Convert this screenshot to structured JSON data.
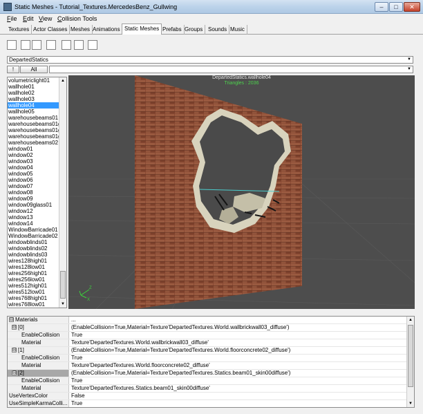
{
  "window": {
    "title": "Static Meshes - Tutorial_Textures.MercedesBenz_Gullwing",
    "min": "–",
    "max": "□",
    "close": "✕"
  },
  "menu": [
    {
      "key": "F",
      "rest": "ile"
    },
    {
      "key": "E",
      "rest": "dit"
    },
    {
      "key": "V",
      "rest": "iew"
    },
    {
      "key": "C",
      "rest": "ollision Tools"
    }
  ],
  "tabs": [
    "Textures",
    "Actor Classes",
    "Meshes",
    "Animations",
    "Static Meshes",
    "Prefabs",
    "Groups",
    "Sounds",
    "Music"
  ],
  "active_tab": "Static Meshes",
  "toolbar": [
    "new-package-icon",
    "open-icon",
    "save-icon",
    "copy-icon",
    "new-document-icon",
    "import-icon",
    "export-icon"
  ],
  "package": {
    "value": "DepartedStatics",
    "arrow": "▼"
  },
  "filter": {
    "excl": "!",
    "all": "All",
    "arrow": "▼"
  },
  "meshes": [
    "volumetriclight01",
    "wallhole01",
    "wallhole02",
    "wallhole03",
    "wallhole04",
    "wallhole05",
    "warehousebeams01",
    "warehousebeams01gl",
    "warehousebeams01gl",
    "warehousebeams01gl",
    "warehousebeams02",
    "window01",
    "window02",
    "window03",
    "window04",
    "window05",
    "window06",
    "window07",
    "window08",
    "window09",
    "window09glass01",
    "window12",
    "window13",
    "window14",
    "WindowBarricade01",
    "WindowBarricade02",
    "windowblinds01",
    "windowblinds02",
    "windowblinds03",
    "wires128high01",
    "wires128low01",
    "wires256high01",
    "wires256low01",
    "wires512high01",
    "wires512low01",
    "wires768high01",
    "wires768low01"
  ],
  "selected_mesh": "wallhole04",
  "viewport": {
    "title": "DepartedStatics.wallhole04",
    "triangles": "Triangles : 2036",
    "axis_z": "Z",
    "axis_x": "X"
  },
  "properties": [
    {
      "name": "Materials",
      "value": "...",
      "exp": "⊟",
      "indent": 0
    },
    {
      "name": "[0]",
      "value": "(EnableCollision=True,Material=Texture'DepartedTextures.World.wallbrickwall03_diffuse')",
      "exp": "⊟",
      "indent": 1
    },
    {
      "name": "EnableCollision",
      "value": "True",
      "indent": 2
    },
    {
      "name": "Material",
      "value": "Texture'DepartedTextures.World.wallbrickwall03_diffuse'",
      "indent": 2
    },
    {
      "name": "[1]",
      "value": "(EnableCollision=True,Material=Texture'DepartedTextures.World.floorconcrete02_diffuse')",
      "exp": "⊟",
      "indent": 1
    },
    {
      "name": "EnableCollision",
      "value": "True",
      "indent": 2
    },
    {
      "name": "Material",
      "value": "Texture'DepartedTextures.World.floorconcrete02_diffuse'",
      "indent": 2
    },
    {
      "name": "[2]",
      "value": "(EnableCollision=True,Material=Texture'DepartedTextures.Statics.beam01_skin00diffuse')",
      "exp": "⊟",
      "indent": 1,
      "selected": true
    },
    {
      "name": "EnableCollision",
      "value": "True",
      "indent": 2
    },
    {
      "name": "Material",
      "value": "Texture'DepartedTextures.Statics.beam01_skin00diffuse'",
      "indent": 2
    },
    {
      "name": "UseVertexColor",
      "value": "False",
      "indent": 0
    },
    {
      "name": "UseSimpleKarmaColli...",
      "value": "True",
      "indent": 0
    }
  ]
}
